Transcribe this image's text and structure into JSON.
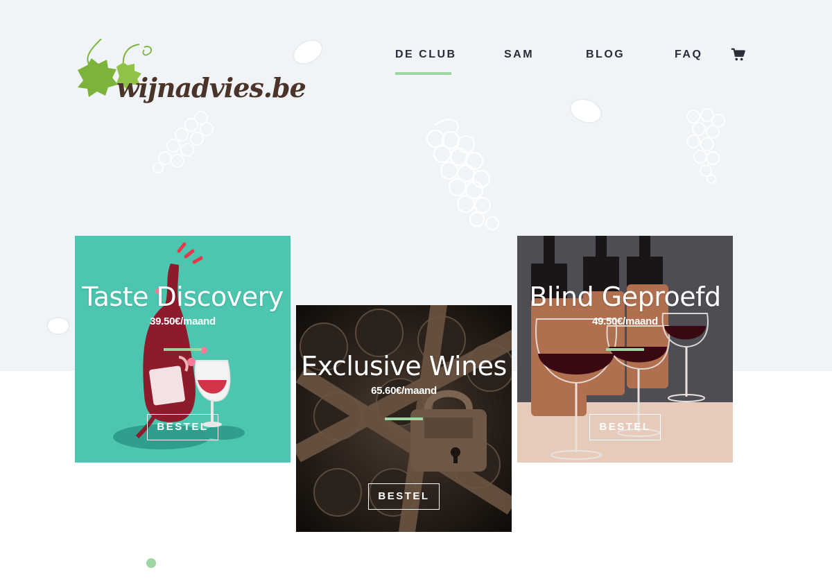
{
  "brand": {
    "logo_text": "wijnadvies.be",
    "leaf_color": "#7db33b",
    "text_color": "#4a342a"
  },
  "nav": {
    "items": [
      {
        "label": "DE CLUB",
        "active": true
      },
      {
        "label": "SAM",
        "active": false
      },
      {
        "label": "BLOG",
        "active": false
      },
      {
        "label": "FAQ",
        "active": false
      }
    ],
    "cart_icon": "shopping-cart-icon",
    "active_underline_color": "#9dd6a3"
  },
  "cards": [
    {
      "title": "Taste Discovery",
      "price": "39.50€/maand",
      "button": "BESTEL",
      "bg_color": "#4dc6b0"
    },
    {
      "title": "Exclusive Wines",
      "price": "65.60€/maand",
      "button": "BESTEL",
      "bg_color": "#2a211c"
    },
    {
      "title": "Blind Geproefd",
      "price": "49.50€/maand",
      "button": "BESTEL",
      "bg_color": "#5b5552"
    }
  ],
  "colors": {
    "hero_bg": "#f0f4f6",
    "accent": "#9dd6a3"
  }
}
